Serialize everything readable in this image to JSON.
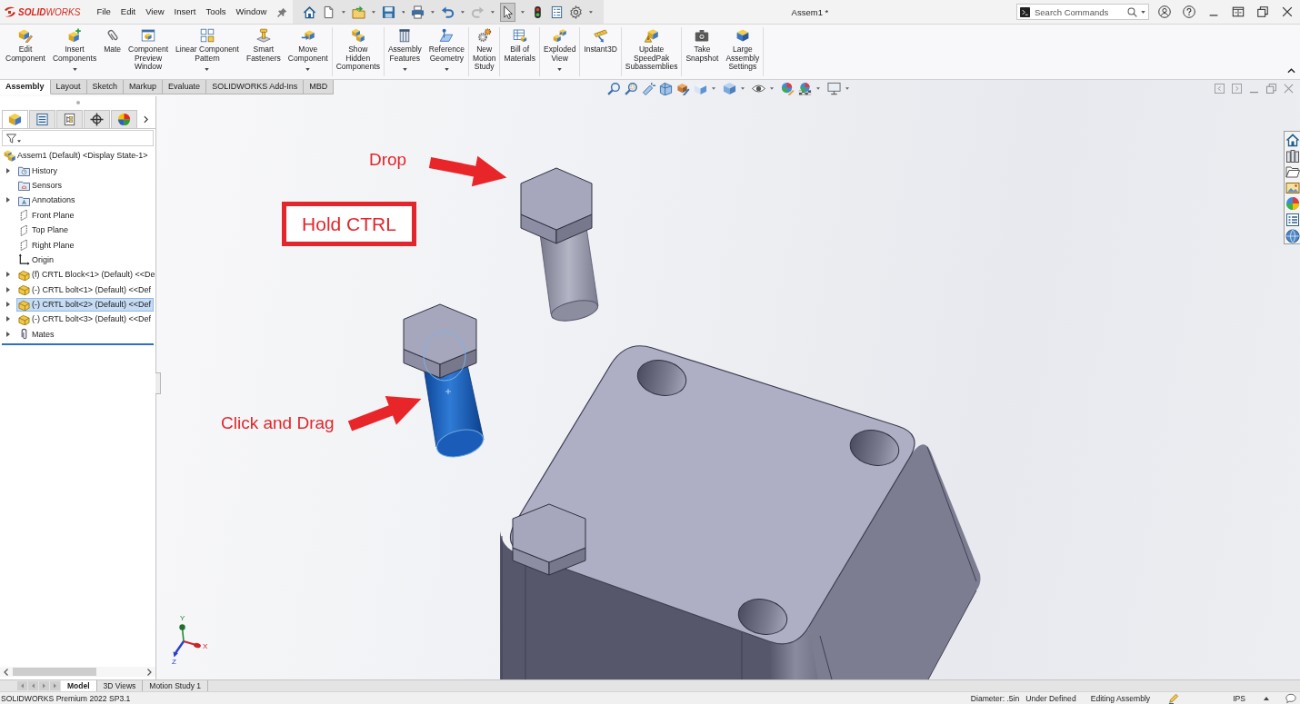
{
  "title_bar": {
    "logo": "**SOLID**WORKS",
    "menu": [
      "File",
      "Edit",
      "View",
      "Insert",
      "Tools",
      "Window"
    ],
    "document_title": "Assem1 *",
    "search": {
      "placeholder": "Search Commands"
    }
  },
  "quick_toolbar": [
    {
      "dropdown": false,
      "active": false,
      "disabled": false
    },
    {
      "dropdown": true,
      "active": false,
      "disabled": false
    },
    {
      "dropdown": true,
      "active": false,
      "disabled": false
    },
    {
      "dropdown": true,
      "active": false,
      "disabled": false
    },
    {
      "dropdown": true,
      "active": false,
      "disabled": false
    },
    {
      "dropdown": true,
      "active": false,
      "disabled": false
    },
    {
      "dropdown": true,
      "active": false,
      "disabled": true
    },
    {
      "dropdown": true,
      "active": true,
      "disabled": false
    },
    {
      "dropdown": false,
      "active": false,
      "disabled": false
    },
    {
      "dropdown": false,
      "active": false,
      "disabled": false
    },
    {
      "dropdown": true,
      "active": false,
      "disabled": false
    }
  ],
  "ribbon": {
    "groups": [
      [
        {
          "label": "Edit\nComponent",
          "dropdown": false
        },
        {
          "label": "Insert\nComponents",
          "dropdown": true
        },
        {
          "label": "Mate",
          "dropdown": false
        },
        {
          "label": "Component\nPreview\nWindow",
          "dropdown": false
        },
        {
          "label": "Linear Component\nPattern",
          "dropdown": true
        },
        {
          "label": "Smart\nFasteners",
          "dropdown": false
        },
        {
          "label": "Move\nComponent",
          "dropdown": true
        }
      ],
      [
        {
          "label": "Show\nHidden\nComponents",
          "dropdown": false
        }
      ],
      [
        {
          "label": "Assembly\nFeatures",
          "dropdown": true
        },
        {
          "label": "Reference\nGeometry",
          "dropdown": true
        }
      ],
      [
        {
          "label": "New\nMotion\nStudy",
          "dropdown": false
        }
      ],
      [
        {
          "label": "Bill of\nMaterials",
          "dropdown": false
        }
      ],
      [
        {
          "label": "Exploded\nView",
          "dropdown": true
        }
      ],
      [
        {
          "label": "Instant3D",
          "dropdown": false
        }
      ],
      [
        {
          "label": "Update\nSpeedPak\nSubassemblies",
          "dropdown": false
        }
      ],
      [
        {
          "label": "Take\nSnapshot",
          "dropdown": false
        },
        {
          "label": "Large\nAssembly\nSettings",
          "dropdown": false
        }
      ]
    ]
  },
  "command_tabs": [
    {
      "label": "Assembly",
      "selected": true
    },
    {
      "label": "Layout",
      "selected": false
    },
    {
      "label": "Sketch",
      "selected": false
    },
    {
      "label": "Markup",
      "selected": false
    },
    {
      "label": "Evaluate",
      "selected": false
    },
    {
      "label": "SOLIDWORKS Add-Ins",
      "selected": false
    },
    {
      "label": "MBD",
      "selected": false
    }
  ],
  "view_toolbar": [
    {
      "dropdown": false
    },
    {
      "dropdown": false
    },
    {
      "dropdown": false
    },
    {
      "dropdown": false
    },
    {
      "dropdown": false
    },
    {
      "dropdown": true
    },
    {
      "dropdown": true
    },
    {
      "dropdown": true
    },
    {
      "dropdown": false
    },
    {
      "dropdown": true
    },
    {
      "dropdown": true
    }
  ],
  "feature_manager": {
    "tabs": [
      {
        "selected": true
      },
      {
        "selected": false
      },
      {
        "selected": false
      },
      {
        "selected": false
      },
      {
        "selected": false
      }
    ],
    "tree": [
      {
        "label": "Assem1 (Default) <Display State-1>",
        "children": [
          {
            "label": "History",
            "expandable": true,
            "selected": false
          },
          {
            "label": "Sensors",
            "expandable": false,
            "selected": false
          },
          {
            "label": "Annotations",
            "expandable": true,
            "selected": false
          },
          {
            "label": "Front Plane",
            "expandable": false,
            "selected": false
          },
          {
            "label": "Top Plane",
            "expandable": false,
            "selected": false
          },
          {
            "label": "Right Plane",
            "expandable": false,
            "selected": false
          },
          {
            "label": "Origin",
            "expandable": false,
            "selected": false
          },
          {
            "label": "(f) CRTL Block<1> (Default) <<De",
            "expandable": true,
            "selected": false
          },
          {
            "label": "(-) CRTL bolt<1> (Default) <<Def",
            "expandable": true,
            "selected": false
          },
          {
            "label": "(-) CRTL bolt<2> (Default) <<Def",
            "expandable": true,
            "selected": true
          },
          {
            "label": "(-) CRTL bolt<3> (Default) <<Def",
            "expandable": true,
            "selected": false
          },
          {
            "label": "Mates",
            "expandable": true,
            "selected": false
          }
        ]
      }
    ]
  },
  "viewport": {
    "annotations": [
      {
        "kind": "label",
        "text": "Drop"
      },
      {
        "kind": "boxed",
        "text": "Hold CTRL"
      },
      {
        "kind": "label",
        "text": "Click and Drag"
      }
    ],
    "bolts": [
      {
        "selected": false
      },
      {
        "selected": true
      }
    ],
    "triad_labels": [
      "Y",
      "X",
      "Z"
    ]
  },
  "bottom_tabs": [
    {
      "label": "Model",
      "selected": true
    },
    {
      "label": "3D Views",
      "selected": false
    },
    {
      "label": "Motion Study 1",
      "selected": false
    }
  ],
  "status_bar": {
    "product": "SOLIDWORKS Premium 2022 SP3.1",
    "fields": [
      "Diameter: .5in",
      "Under Defined",
      "Editing Assembly"
    ],
    "units": "IPS"
  }
}
